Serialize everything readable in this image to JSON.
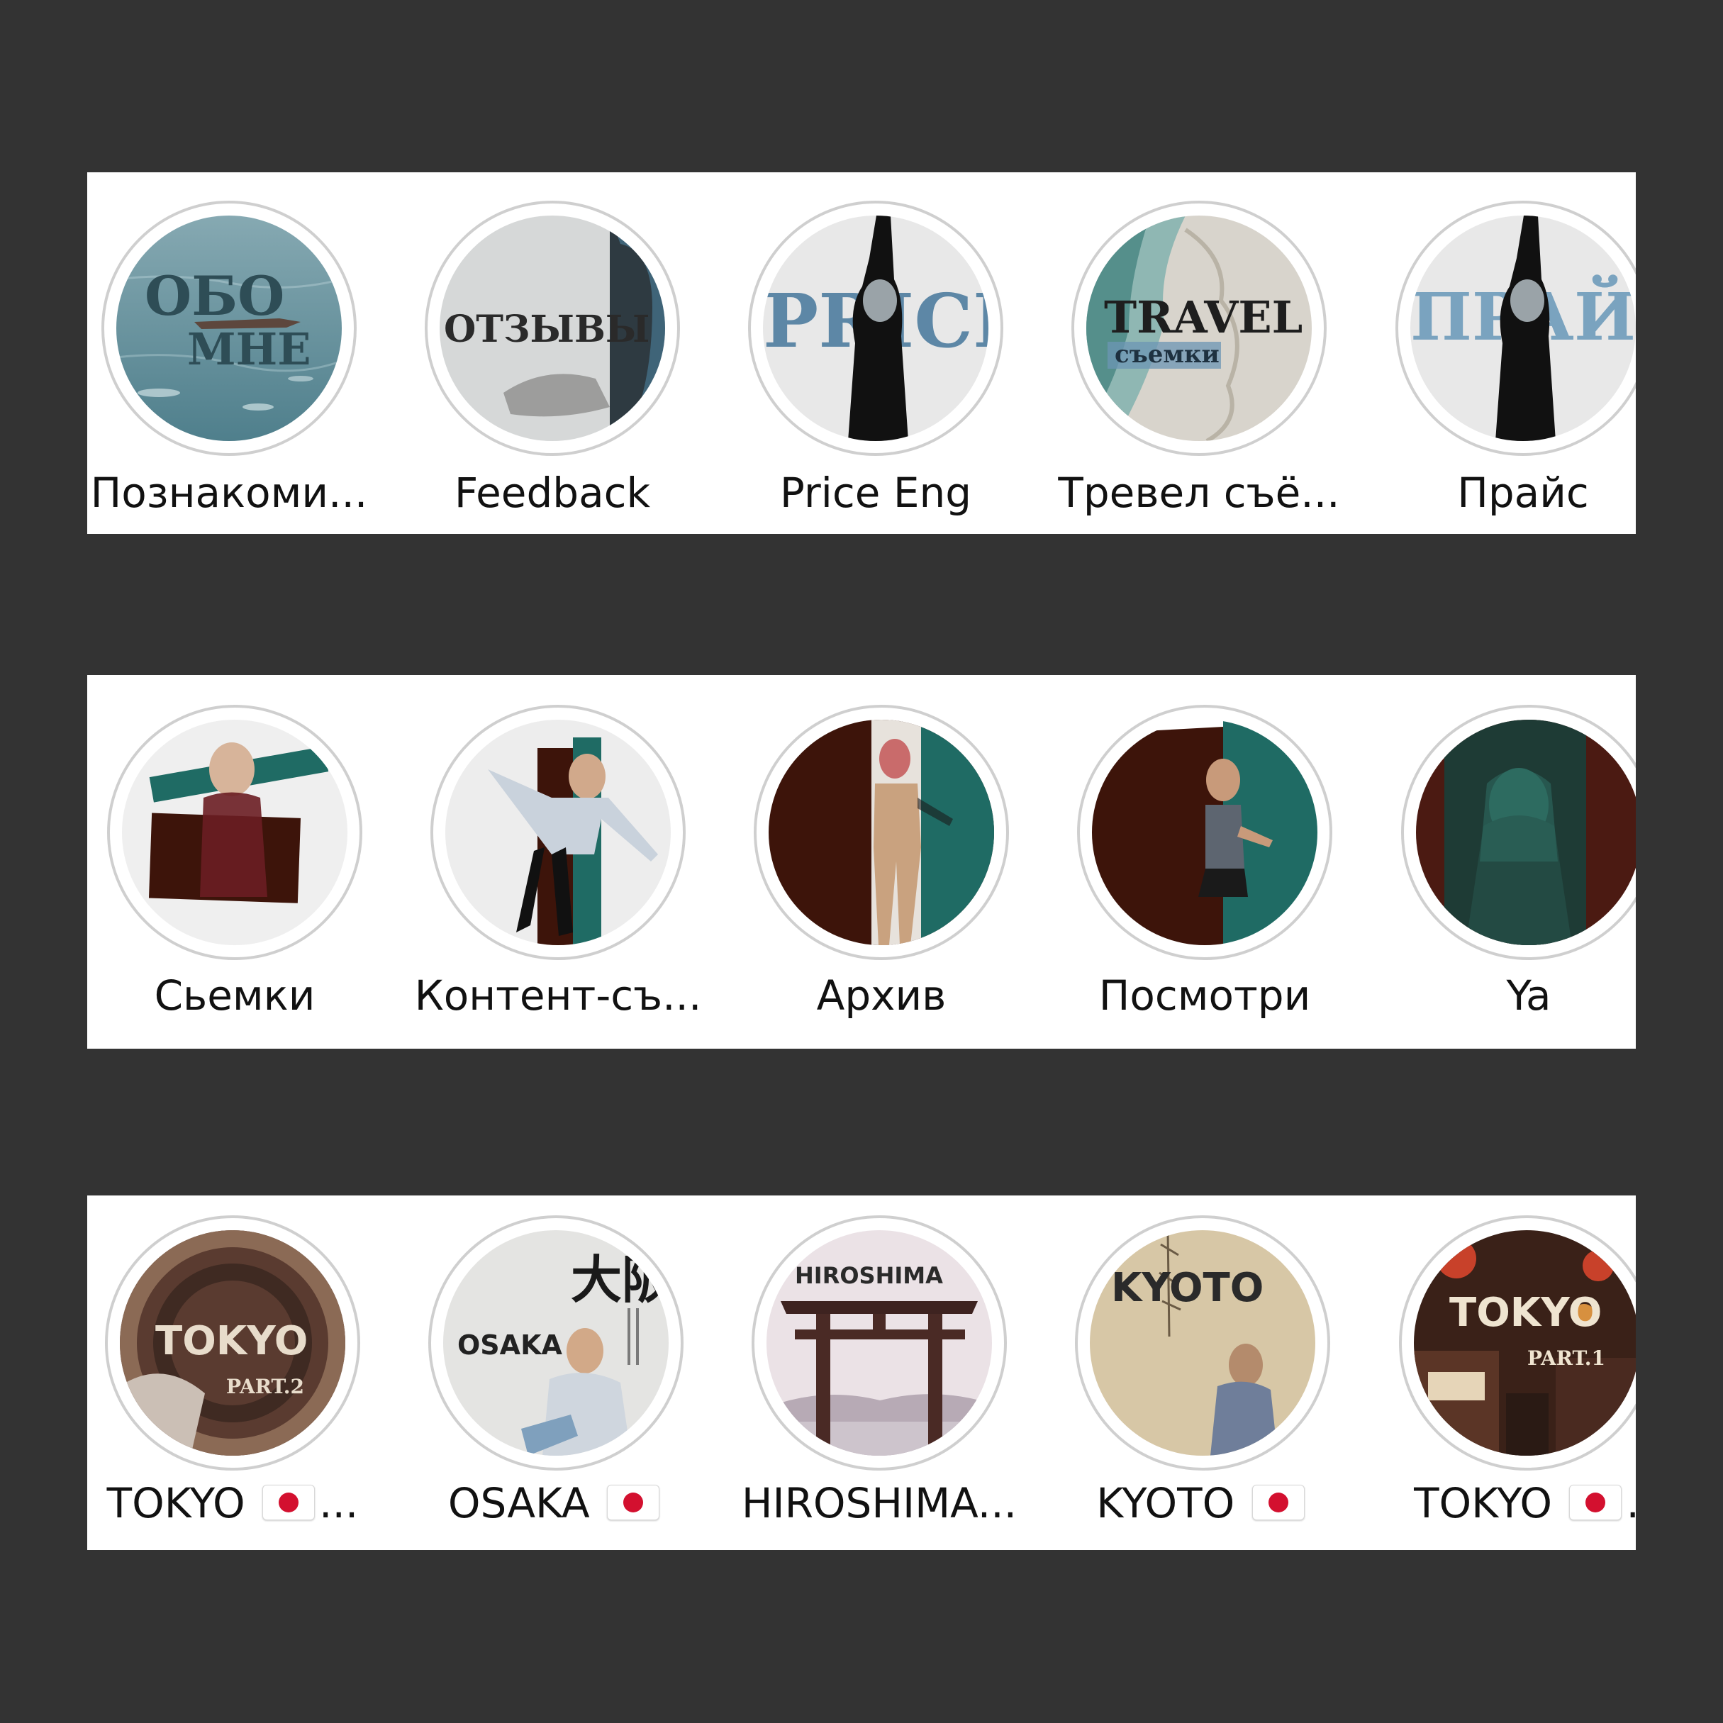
{
  "rows": [
    {
      "items": [
        {
          "label": "Познакоми...",
          "cover_text": [
            "ОБО",
            "МНЕ"
          ],
          "colors": {
            "bg": "#6f97a3",
            "accent": "#2e4d56"
          }
        },
        {
          "label": "Feedback",
          "cover_text": [
            "ОТЗЫВЫ"
          ],
          "colors": {
            "bg": "#d4d6d6",
            "accent": "#3f6478"
          }
        },
        {
          "label": "Price Eng",
          "cover_text": [
            "PRICE"
          ],
          "colors": {
            "bg": "#e6e6e6",
            "accent": "#5d87a6"
          }
        },
        {
          "label": "Тревел съё...",
          "cover_text": [
            "TRAVEL",
            "съемки"
          ],
          "colors": {
            "bg": "#d9d6cf",
            "accent": "#3c7d7a"
          }
        },
        {
          "label": "Прайс",
          "cover_text": [
            "ПРАЙС"
          ],
          "colors": {
            "bg": "#e6e6e6",
            "accent": "#7aa3bf"
          }
        }
      ]
    },
    {
      "items": [
        {
          "label": "Сьемки",
          "colors": {
            "bg": "#efefef",
            "accent1": "#1f6b64",
            "accent2": "#3d140a"
          }
        },
        {
          "label": "Контент-съ...",
          "colors": {
            "bg": "#ededed",
            "accent1": "#1f6b64",
            "accent2": "#3d140a"
          }
        },
        {
          "label": "Архив",
          "colors": {
            "bg": "#3d140a",
            "accent1": "#1f6b64",
            "accent2": "#e7e2dc"
          }
        },
        {
          "label": "Посмотри",
          "colors": {
            "bg": "#3d140a",
            "accent1": "#1f6b64",
            "accent2": "#ffffff"
          }
        },
        {
          "label": "Ya",
          "colors": {
            "bg": "#4b1a12",
            "accent1": "#1e3b35",
            "accent2": "#2d6b60"
          }
        }
      ]
    },
    {
      "items": [
        {
          "label": "TOKYO",
          "suffix": "...",
          "flag": "japan-flag",
          "cover_text": [
            "TOKYO",
            "PART.2"
          ],
          "colors": {
            "bg": "#5a3b30",
            "accent": "#d8c4a8"
          }
        },
        {
          "label": "OSAKA",
          "suffix": "",
          "flag": "japan-flag",
          "cover_text": [
            "OSAKA",
            "大阪"
          ],
          "colors": {
            "bg": "#e4e4e2",
            "accent": "#1a1a1a"
          }
        },
        {
          "label": "HIROSHIMA...",
          "suffix": "",
          "flag": "",
          "cover_text": [
            "HIROSHIMA"
          ],
          "colors": {
            "bg": "#e9dfe3",
            "accent": "#4a2a25"
          }
        },
        {
          "label": "KYOTO",
          "suffix": "",
          "flag": "japan-flag",
          "cover_text": [
            "KYOTO"
          ],
          "colors": {
            "bg": "#d7c7a6",
            "accent": "#2a2a2a"
          }
        },
        {
          "label": "TOKYO",
          "suffix": ".",
          "flag": "japan-flag",
          "cover_text": [
            "TOKYO",
            "PART.1"
          ],
          "colors": {
            "bg": "#3a2118",
            "accent": "#c8412a"
          }
        }
      ]
    }
  ]
}
